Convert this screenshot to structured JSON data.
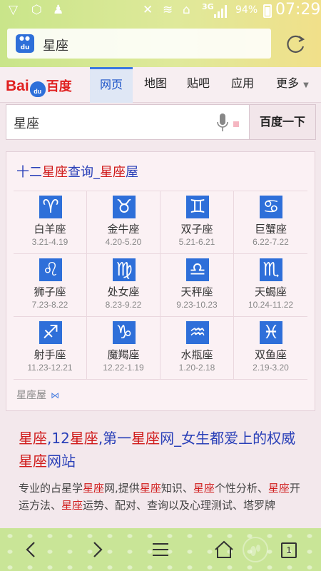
{
  "status": {
    "network": "3G",
    "battery": "94%",
    "time": "07:29"
  },
  "address_bar": {
    "query": "星座"
  },
  "nav": {
    "brand_latin_1": "Bai",
    "brand_latin_2": "du",
    "brand_cn": "百度",
    "tabs": [
      "网页",
      "地图",
      "贴吧",
      "应用",
      "更多"
    ],
    "active_tab": "网页"
  },
  "search": {
    "value": "星座",
    "button": "百度一下"
  },
  "zodiac_card": {
    "title_parts": [
      "十二",
      "星座",
      "查询_",
      "星座",
      "屋"
    ],
    "signs": [
      {
        "symbol": "♈",
        "name": "白羊座",
        "dates": "3.21-4.19"
      },
      {
        "symbol": "♉",
        "name": "金牛座",
        "dates": "4.20-5.20"
      },
      {
        "symbol": "♊",
        "name": "双子座",
        "dates": "5.21-6.21"
      },
      {
        "symbol": "♋",
        "name": "巨蟹座",
        "dates": "6.22-7.22"
      },
      {
        "symbol": "♌",
        "name": "狮子座",
        "dates": "7.23-8.22"
      },
      {
        "symbol": "♍",
        "name": "处女座",
        "dates": "8.23-9.22"
      },
      {
        "symbol": "♎",
        "name": "天秤座",
        "dates": "9.23-10.23"
      },
      {
        "symbol": "♏",
        "name": "天蝎座",
        "dates": "10.24-11.22"
      },
      {
        "symbol": "♐",
        "name": "射手座",
        "dates": "11.23-12.21"
      },
      {
        "symbol": "♑",
        "name": "魔羯座",
        "dates": "12.22-1.19"
      },
      {
        "symbol": "♒",
        "name": "水瓶座",
        "dates": "1.20-2.18"
      },
      {
        "symbol": "♓",
        "name": "双鱼座",
        "dates": "2.19-3.20"
      }
    ],
    "source": "星座屋"
  },
  "result": {
    "title_parts": [
      "星座",
      ",12",
      "星座",
      ",第一",
      "星座",
      "网_女生都爱上的权威",
      "星座",
      "网站"
    ],
    "desc_parts": [
      "专业的占星学",
      "星座",
      "网,提供",
      "星座",
      "知识、",
      "星座",
      "个性分析、",
      "星座",
      "开运方法、",
      "星座",
      "运势、配对、查询以及心理测试、塔罗牌"
    ]
  },
  "toolbar": {
    "tab_count": "1"
  }
}
